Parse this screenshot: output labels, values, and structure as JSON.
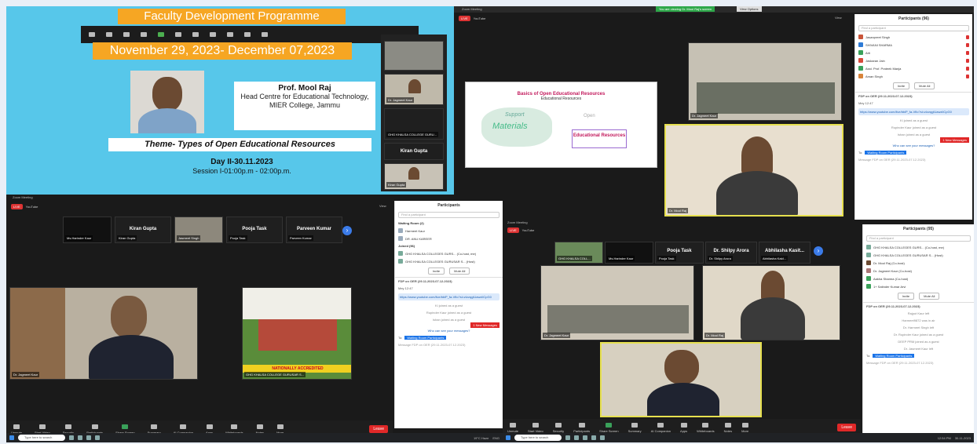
{
  "fdp_slide": {
    "title": "Faculty Development Programme",
    "dates": "November 29, 2023- December 07,2023",
    "speaker_name": "Prof. Mool Raj",
    "speaker_role": "Head Centre for Educational Technology, MIER College, Jammu",
    "theme": "Theme- Types of Open Educational Resources",
    "day": "Day II-30.11.2023",
    "session": "Session I-01:00p.m - 02:00p.m.",
    "tile_names": [
      "Dr. Jagmeet Kaur",
      "GHG KHALSA COLLEGE GURU...",
      "Kiran Gupta",
      "Kiran Gupta"
    ]
  },
  "zoom_common": {
    "window_title": "Zoom Meeting",
    "rec_badge": "LIVE",
    "youtube": "YouTube",
    "view": "View",
    "toolbar": [
      "Unmute",
      "Start Video",
      "Security",
      "Participants",
      "Share Screen",
      "Summary",
      "AI Companion",
      "Apps",
      "Whiteboards",
      "Notes",
      "More"
    ],
    "leave": "Leave",
    "search_taskbar": "Type here to search"
  },
  "top_right": {
    "banner": "You are viewing Dr. Mool Raj's screen",
    "view_options": "View Options",
    "slide_title": "Basics of Open Educational Resources",
    "slide_subtitle": "Educational Resources",
    "slide_words": [
      "Open",
      "Support",
      "Materials",
      "Educational Resources"
    ],
    "tiles": [
      "Dr. Jagmeet Kaur",
      "Dr. Mool Raj"
    ],
    "participants_header": "Participants (96)",
    "find_participant": "Find a participant",
    "participants": [
      "Jasanpreet Singh",
      "SHIVANI SHARMA",
      "Arti",
      "Jaskaran Jain",
      "Asst. Prof. Prateek Manja",
      "Aman Singh"
    ],
    "invite": "Invite",
    "mute_all": "Mute All",
    "chat_header": "FDP on OER (29.11.2023-07.12.2023)",
    "chat_from": "Mey 12:47",
    "chat_link": "https://www.youtube.com/live/bbiP_fa-Vflo?si=zIzzqgiUawzIiCpG0",
    "chat_sys": [
      "Ki joined as a guest",
      "Rupinder Kaur joined as a guest",
      "Ishan joined as a guest"
    ],
    "new_messages": "1 New Messages",
    "who_see": "Who can see your messages?",
    "to_label": "To:",
    "waiting": "Waiting Room Participants",
    "msg_placeholder": "Message FDP on OER (29.11.2023-07.12.2023)"
  },
  "bottom_left": {
    "strip": [
      "Ms.Harinder Kaur",
      "Kiran Gupta",
      "Jasmeet Singh",
      "Pooja Task",
      "Parveen Kumar"
    ],
    "strip_labels": [
      "Kiran Gupta",
      "Pooja Task",
      "Parveen Kumar"
    ],
    "main_tiles": [
      "Dr. Jagmeet Kaur",
      "GHG KHALSA COLLEGE GURUSAR S..."
    ],
    "college_banner": "NATIONALLY ACCREDITED",
    "participants_header": "Participants",
    "find_participant": "Find a participant",
    "waiting_room": "Waiting Room (2)",
    "waiting_list": [
      "Harmeet Kaur",
      "DR. ANU KAREER"
    ],
    "joined": "Joined (96)",
    "joined_list": [
      "GHG KHALSA COLLEGES GURS... (Co-host, me)",
      "GHG KHALSA COLLEGES GURUSAR S... (Host)"
    ],
    "invite": "Invite",
    "mute_all": "Mute All",
    "chat_header": "FDP on OER (29.11.2023-07.12.2023)",
    "chat_from": "Mey 12:47",
    "chat_link": "https://www.youtube.com/live/bbiP_fa-Vflo?si=zIzzqgiUawzIiCpG0",
    "chat_sys": [
      "Ki joined as a guest",
      "Rupinder Kaur joined as a guest",
      "Ishan joined as a guest"
    ],
    "new_messages": "1 New Messages",
    "who_see": "Who can see your messages?",
    "to_label": "To:",
    "waiting": "Waiting Room Participants",
    "msg_placeholder": "Message FDP on OER (29.11.2023-07.12.2023)"
  },
  "bottom_right": {
    "strip": [
      "GHG KHALSA COLL...",
      "Ms.Harinder Kaur",
      "Pooja Task",
      "Dr. Shilpy Arora",
      "Abhilasha Kaid..."
    ],
    "strip_labels": [
      "Pooja Task",
      "Dr. Shilpy Arora",
      "Abhilasha Kasit..."
    ],
    "tiles": [
      "Dr. Jagmeet Kaur",
      "Dr. Mool Raj",
      "Dr. Jagmeet Kaur"
    ],
    "participants_header": "Participants (95)",
    "find_participant": "Find a participant",
    "participants": [
      "GHG KHALSA COLLEGES GURS... (Co-host, me)",
      "GHG KHALSA COLLEGES GURUSAR S... (Host)",
      "Dr. Mool Raj (Co-host)",
      "Dr. Jagmeet Kaur (Co-host)",
      "Aakha Sharma (Co-host)",
      "1+ Satinder Kumar Arvi"
    ],
    "invite": "Invite",
    "mute_all": "Mute All",
    "chat_header": "FDP on OER (29.11.2023-07.12.2023)",
    "chat_sys": [
      "Rajput Kaur left",
      "Harmeet9872 was in air",
      "Dr. Harmeet Singh left",
      "Dr. Rupinder Kaur joined as a guest",
      "DEEP PRM joined as a guest",
      "Dr. Jasmeet Kaur left"
    ],
    "to_label": "To:",
    "waiting": "Waiting Room Participants",
    "msg_placeholder": "Message FDP on OER (29.11.2023-07.12.2023)",
    "time": "12:54 PM",
    "date": "30-11-2023"
  },
  "taskbar_left": {
    "temp": "19°C Haze",
    "lang": "ENG"
  }
}
